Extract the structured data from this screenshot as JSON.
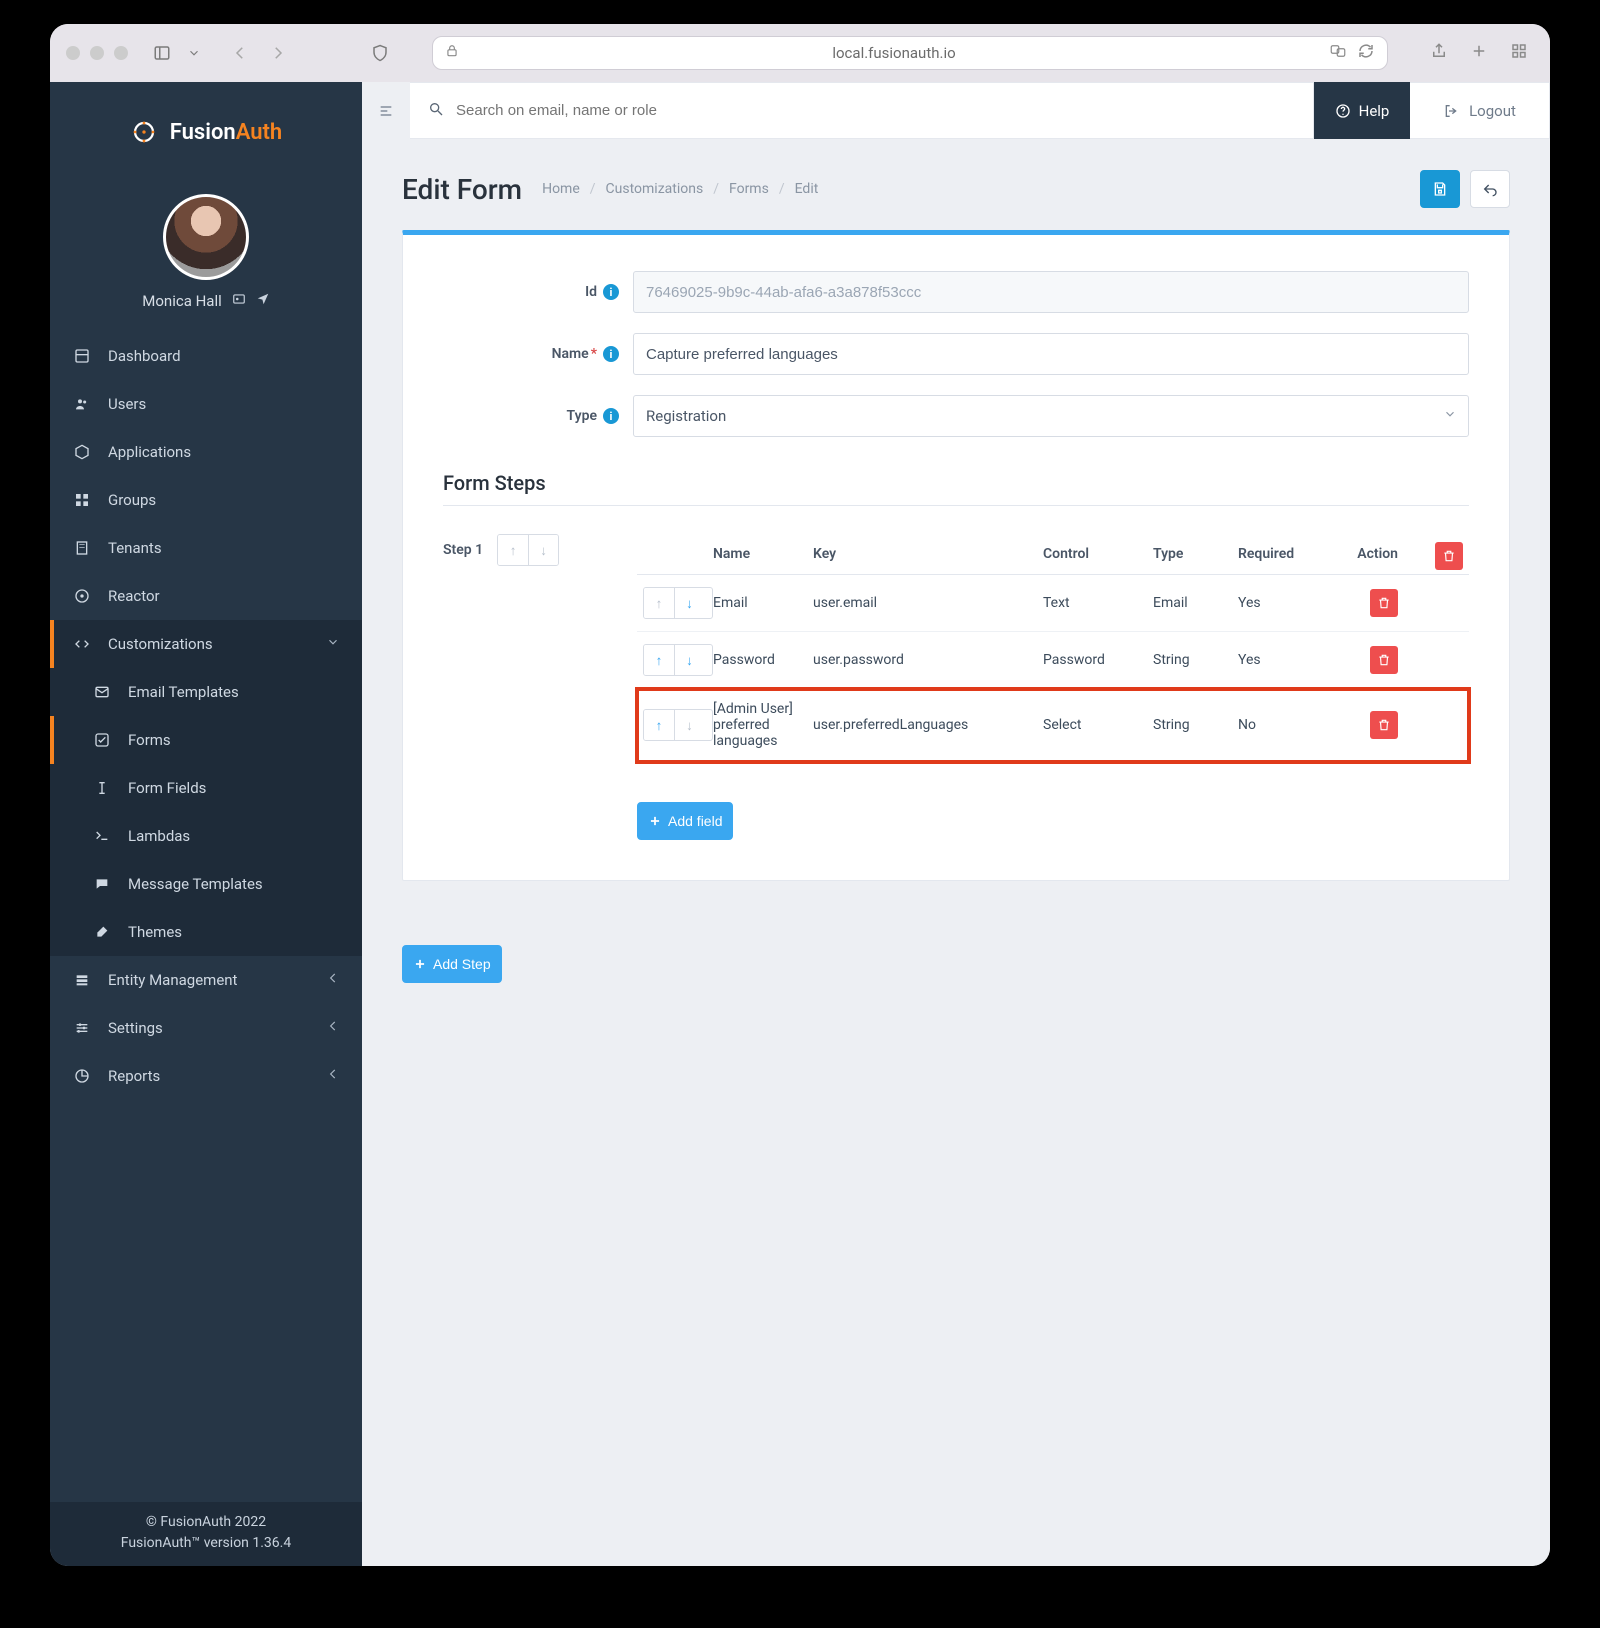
{
  "browser": {
    "url_host": "local.fusionauth.io"
  },
  "brand": {
    "name_pre": "Fusion",
    "name_post": "Auth"
  },
  "profile": {
    "name": "Monica Hall"
  },
  "sidebar": {
    "dashboard": "Dashboard",
    "users": "Users",
    "applications": "Applications",
    "groups": "Groups",
    "tenants": "Tenants",
    "reactor": "Reactor",
    "customizations": "Customizations",
    "email_templates": "Email Templates",
    "forms": "Forms",
    "form_fields": "Form Fields",
    "lambdas": "Lambdas",
    "message_templates": "Message Templates",
    "themes": "Themes",
    "entity_management": "Entity Management",
    "settings": "Settings",
    "reports": "Reports"
  },
  "footer": {
    "line1": "© FusionAuth 2022",
    "line2": "FusionAuth™ version 1.36.4"
  },
  "topbar": {
    "search_placeholder": "Search on email, name or role",
    "help": "Help",
    "logout": "Logout"
  },
  "page": {
    "title": "Edit Form",
    "crumbs": [
      "Home",
      "Customizations",
      "Forms",
      "Edit"
    ]
  },
  "form": {
    "id_label": "Id",
    "id_value": "76469025-9b9c-44ab-afa6-a3a878f53ccc",
    "name_label": "Name",
    "name_value": "Capture preferred languages",
    "type_label": "Type",
    "type_value": "Registration"
  },
  "steps": {
    "section_title": "Form Steps",
    "step1_label": "Step 1",
    "columns": {
      "name": "Name",
      "key": "Key",
      "control": "Control",
      "type": "Type",
      "required": "Required",
      "action": "Action"
    },
    "rows": [
      {
        "name": "Email",
        "key": "user.email",
        "control": "Text",
        "type": "Email",
        "required": "Yes",
        "highlight": false,
        "up_dim": true,
        "down_dim": false
      },
      {
        "name": "Password",
        "key": "user.password",
        "control": "Password",
        "type": "String",
        "required": "Yes",
        "highlight": false,
        "up_dim": false,
        "down_dim": false
      },
      {
        "name": "[Admin User] preferred languages",
        "key": "user.preferredLanguages",
        "control": "Select",
        "type": "String",
        "required": "No",
        "highlight": true,
        "up_dim": false,
        "down_dim": true
      }
    ],
    "add_field": "Add field",
    "add_step": "Add Step"
  }
}
